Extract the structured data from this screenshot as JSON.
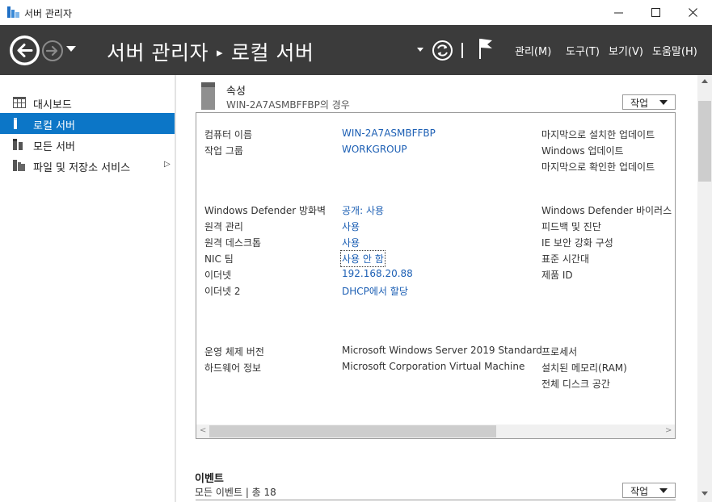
{
  "window": {
    "title": "서버 관리자",
    "minimize_glyph": "—",
    "maximize_glyph": "☐",
    "close_glyph": "✕"
  },
  "header": {
    "breadcrumb_root": "서버 관리자",
    "breadcrumb_sep": "▸",
    "breadcrumb_current": "로컬 서버",
    "menus": [
      "관리(M)",
      "도구(T)",
      "보기(V)",
      "도움말(H)"
    ]
  },
  "nav": {
    "items": [
      {
        "label": "대시보드",
        "icon": "dashboard-icon"
      },
      {
        "label": "로컬 서버",
        "icon": "local-server-icon",
        "selected": true
      },
      {
        "label": "모든 서버",
        "icon": "all-servers-icon"
      },
      {
        "label": "파일 및 저장소 서비스",
        "icon": "file-storage-icon",
        "chevron": "▷"
      }
    ]
  },
  "properties": {
    "title": "속성",
    "subtitle": "WIN-2A7ASMBFFBP의 경우",
    "task_label": "작업",
    "left": [
      {
        "label": "컴퓨터 이름",
        "value": "WIN-2A7ASMBFFBP"
      },
      {
        "label": "작업 그룹",
        "value": "WORKGROUP"
      },
      {
        "label": "Windows Defender 방화벽",
        "value": "공개: 사용"
      },
      {
        "label": "원격 관리",
        "value": "사용"
      },
      {
        "label": "원격 데스크톱",
        "value": "사용"
      },
      {
        "label": "NIC 팀",
        "value": "사용 안 함"
      },
      {
        "label": "이더넷",
        "value": "192.168.20.88"
      },
      {
        "label": "이더넷 2",
        "value": "DHCP에서 할당"
      },
      {
        "label": "운영 체제 버전",
        "value": "Microsoft Windows Server 2019 Standard"
      },
      {
        "label": "하드웨어 정보",
        "value": "Microsoft Corporation Virtual Machine"
      }
    ],
    "right": [
      "마지막으로 설치한 업데이트",
      "Windows 업데이트",
      "마지막으로 확인한 업데이트",
      "Windows Defender 바이러스 백",
      "피드백 및 진단",
      "IE 보안 강화 구성",
      "표준 시간대",
      "제품 ID",
      "프로세서",
      "설치된 메모리(RAM)",
      "전체 디스크 공간"
    ]
  },
  "events": {
    "title": "이벤트",
    "subtitle": "모든 이벤트 | 총 18",
    "task_label": "작업"
  },
  "scroll": {
    "left_arrow": "<",
    "right_arrow": ">"
  },
  "colors": {
    "header_bg": "#3b3b3b",
    "nav_selected": "#0c76c7",
    "link": "#1c5fb4"
  }
}
